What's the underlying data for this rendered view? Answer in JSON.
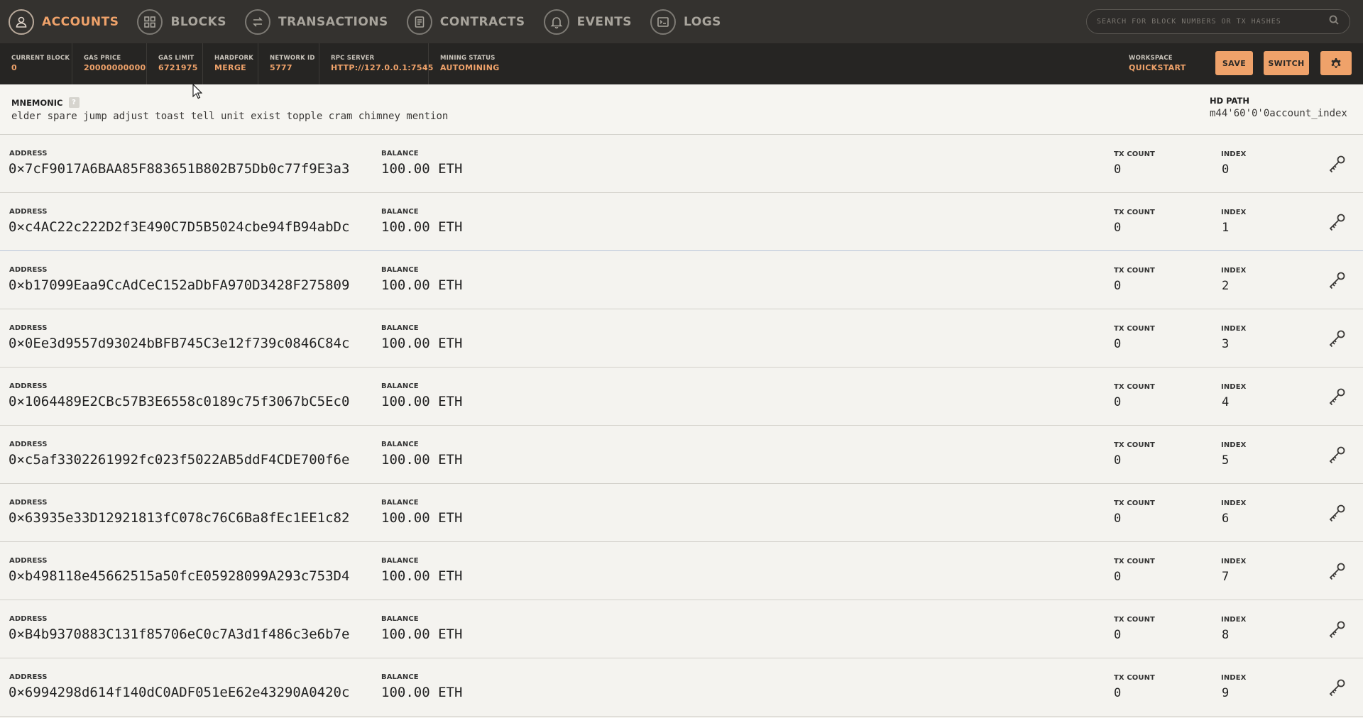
{
  "nav": {
    "items": [
      {
        "label": "ACCOUNTS",
        "icon": "user-icon",
        "active": true
      },
      {
        "label": "BLOCKS",
        "icon": "blocks-icon",
        "active": false
      },
      {
        "label": "TRANSACTIONS",
        "icon": "transactions-icon",
        "active": false
      },
      {
        "label": "CONTRACTS",
        "icon": "contracts-icon",
        "active": false
      },
      {
        "label": "EVENTS",
        "icon": "bell-icon",
        "active": false
      },
      {
        "label": "LOGS",
        "icon": "logs-icon",
        "active": false
      }
    ],
    "search_placeholder": "SEARCH FOR BLOCK NUMBERS OR TX HASHES"
  },
  "status": {
    "current_block": {
      "label": "CURRENT BLOCK",
      "value": "0"
    },
    "gas_price": {
      "label": "GAS PRICE",
      "value": "20000000000"
    },
    "gas_limit": {
      "label": "GAS LIMIT",
      "value": "6721975"
    },
    "hardfork": {
      "label": "HARDFORK",
      "value": "MERGE"
    },
    "network_id": {
      "label": "NETWORK ID",
      "value": "5777"
    },
    "rpc_server": {
      "label": "RPC SERVER",
      "value": "HTTP://127.0.0.1:7545"
    },
    "mining_status": {
      "label": "MINING STATUS",
      "value": "AUTOMINING"
    },
    "workspace": {
      "label": "WORKSPACE",
      "value": "QUICKSTART"
    },
    "save_label": "SAVE",
    "switch_label": "SWITCH"
  },
  "mnemonic": {
    "title": "MNEMONIC",
    "help": "?",
    "words": "elder spare jump adjust toast tell unit exist topple cram chimney mention",
    "hd_path_title": "HD PATH",
    "hd_path": "m44'60'0'0account_index"
  },
  "labels": {
    "address": "ADDRESS",
    "balance": "BALANCE",
    "tx_count": "TX COUNT",
    "index": "INDEX"
  },
  "accounts": [
    {
      "address": "0×7cF9017A6BAA85F883651B802B75Db0c77f9E3a3",
      "balance": "100.00 ETH",
      "tx_count": "0",
      "index": "0"
    },
    {
      "address": "0×c4AC22c222D2f3E490C7D5B5024cbe94fB94abDc",
      "balance": "100.00 ETH",
      "tx_count": "0",
      "index": "1"
    },
    {
      "address": "0×b17099Eaa9CcAdCeC152aDbFA970D3428F275809",
      "balance": "100.00 ETH",
      "tx_count": "0",
      "index": "2"
    },
    {
      "address": "0×0Ee3d9557d93024bBFB745C3e12f739c0846C84c",
      "balance": "100.00 ETH",
      "tx_count": "0",
      "index": "3"
    },
    {
      "address": "0×1064489E2CBc57B3E6558c0189c75f3067bC5Ec0",
      "balance": "100.00 ETH",
      "tx_count": "0",
      "index": "4"
    },
    {
      "address": "0×c5af3302261992fc023f5022AB5ddF4CDE700f6e",
      "balance": "100.00 ETH",
      "tx_count": "0",
      "index": "5"
    },
    {
      "address": "0×63935e33D12921813fC078c76C6Ba8fEc1EE1c82",
      "balance": "100.00 ETH",
      "tx_count": "0",
      "index": "6"
    },
    {
      "address": "0×b498118e45662515a50fcE05928099A293c753D4",
      "balance": "100.00 ETH",
      "tx_count": "0",
      "index": "7"
    },
    {
      "address": "0×B4b9370883C131f85706eC0c7A3d1f486c3e6b7e",
      "balance": "100.00 ETH",
      "tx_count": "0",
      "index": "8"
    },
    {
      "address": "0×6994298d614f140dC0ADF051eE62e43290A0420c",
      "balance": "100.00 ETH",
      "tx_count": "0",
      "index": "9"
    }
  ],
  "colors": {
    "accent": "#efa26a",
    "nav_bg": "#34322f",
    "status_bg": "#262523",
    "page_bg": "#f4f3ef"
  }
}
